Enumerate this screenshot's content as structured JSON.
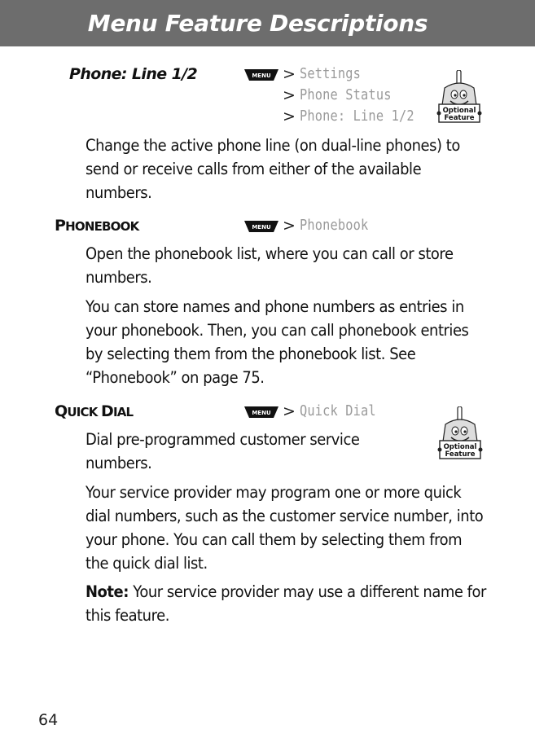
{
  "header": {
    "title": "Menu Feature Descriptions"
  },
  "icons": {
    "menu_key_label": "MENU",
    "optional_badge": [
      "Optional",
      "Feature"
    ]
  },
  "entries": [
    {
      "title": "Phone: Line 1/2",
      "path": [
        "Settings",
        "Phone Status",
        "Phone: Line 1/2"
      ],
      "optional": true,
      "paragraphs": [
        "Change the active phone line (on dual-line phones) to send or receive calls from either of the available numbers."
      ]
    },
    {
      "title_first": "P",
      "title_rest": "HONEBOOK",
      "path": [
        "Phonebook"
      ],
      "optional": false,
      "paragraphs": [
        "Open the phonebook list, where you can call or store numbers.",
        "You can store names and phone numbers as entries in your phonebook. Then, you can call phonebook entries by selecting them from the phonebook list. See “Phonebook” on page 75."
      ]
    },
    {
      "title_first1": "Q",
      "title_rest1": "UICK ",
      "title_first2": "D",
      "title_rest2": "IAL",
      "path": [
        "Quick Dial"
      ],
      "optional": true,
      "paragraphs": [
        "Dial pre-programmed customer service numbers.",
        "Your service provider may program one or more quick dial numbers, such as the customer service number, into your phone. You can call them by selecting them from the quick dial list."
      ],
      "note_label": "Note:",
      "note_text": " Your service provider may use a different name for this feature."
    }
  ],
  "page_number": "64"
}
